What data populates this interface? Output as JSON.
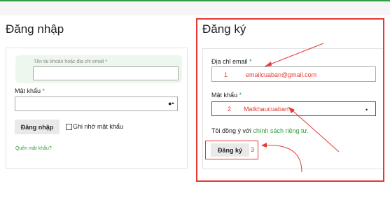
{
  "login": {
    "title": "Đăng nhập",
    "username_placeholder": "Tên tài khoản hoặc địa chỉ email",
    "password_label": "Mật khẩu",
    "submit_label": "Đăng nhập",
    "remember_label": "Ghi nhớ mật khẩu",
    "forgot_link": "Quên mật khẩu?"
  },
  "register": {
    "title": "Đăng ký",
    "email_label": "Địa chỉ email",
    "email_value": "emailcuaban@gmail.com",
    "password_label": "Mật khẩu",
    "password_value": "Matkhaucuaban",
    "privacy_prefix": "Tôi đồng ý với",
    "privacy_link": "chính sách riêng tư.",
    "submit_label": "Đăng ký"
  },
  "required_mark": "*",
  "annotations": {
    "step1": "1",
    "step2": "2",
    "step3": "3"
  },
  "colors": {
    "accent": "#2e9e3e",
    "annotation": "#e53935"
  }
}
